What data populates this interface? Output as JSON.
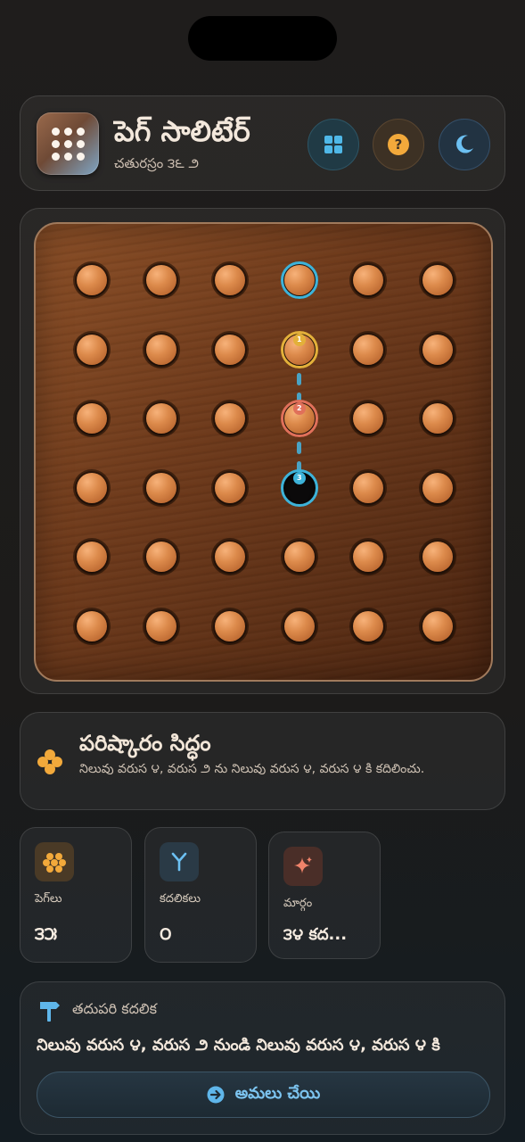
{
  "header": {
    "title": "పెగ్ సాలిటేర్",
    "subtitle": "చతురస్రం ౩౬ ౨",
    "buttons": [
      {
        "name": "grid",
        "icon": "grid-icon",
        "color": "#4fb8e8"
      },
      {
        "name": "help",
        "icon": "question-icon",
        "color": "#f2a93b"
      },
      {
        "name": "theme",
        "icon": "moon-icon",
        "color": "#6cc0f2"
      }
    ]
  },
  "board": {
    "rows": 6,
    "cols": 6,
    "holes": [
      [
        1,
        1,
        1,
        1,
        1,
        1
      ],
      [
        1,
        1,
        1,
        1,
        1,
        1
      ],
      [
        1,
        1,
        1,
        1,
        1,
        1
      ],
      [
        1,
        1,
        1,
        0,
        1,
        1
      ],
      [
        1,
        1,
        1,
        1,
        1,
        1
      ],
      [
        1,
        1,
        1,
        1,
        1,
        1
      ]
    ],
    "highlights": [
      {
        "row": 0,
        "col": 3,
        "color": "#3db3d9",
        "label": ""
      },
      {
        "row": 1,
        "col": 3,
        "color": "#e3b03a",
        "label": "1"
      },
      {
        "row": 2,
        "col": 3,
        "color": "#e0705a",
        "label": "2"
      },
      {
        "row": 3,
        "col": 3,
        "color": "#3db3d9",
        "label": "3"
      }
    ],
    "path": {
      "col": 3,
      "from_row": 1,
      "to_row": 3,
      "color": "#4aa3c4"
    }
  },
  "status": {
    "title": "పరిష్కారం సిద్ధం",
    "description": "నిలువు వరుస ౪, వరుస ౨ ను నిలువు వరుస ౪, వరుస ౪ కి కదిలించు.",
    "icon": "flower-icon",
    "icon_color": "#f2a93b"
  },
  "stats": [
    {
      "label": "పెగ్‌లు",
      "value": "౩౫",
      "icon": "pegs-icon",
      "icon_bg": "#4a3a26",
      "icon_color": "#f2a93b"
    },
    {
      "label": "కదలికలు",
      "value": "౦",
      "icon": "branch-icon",
      "icon_bg": "#2a3a46",
      "icon_color": "#6cc0f2"
    },
    {
      "label": "మార్గం",
      "value": "౩౪ కద...",
      "icon": "sparkle-icon",
      "icon_bg": "#4a2e28",
      "icon_color": "#f0836a"
    }
  ],
  "next_move": {
    "heading": "తదుపరి కదలిక",
    "text": "నిలువు వరుస ౪, వరుస ౨ నుండి నిలువు వరుస ౪, వరుస ౪ కి",
    "button_label": "అమలు చేయి",
    "icon_color": "#5fb6ea"
  }
}
